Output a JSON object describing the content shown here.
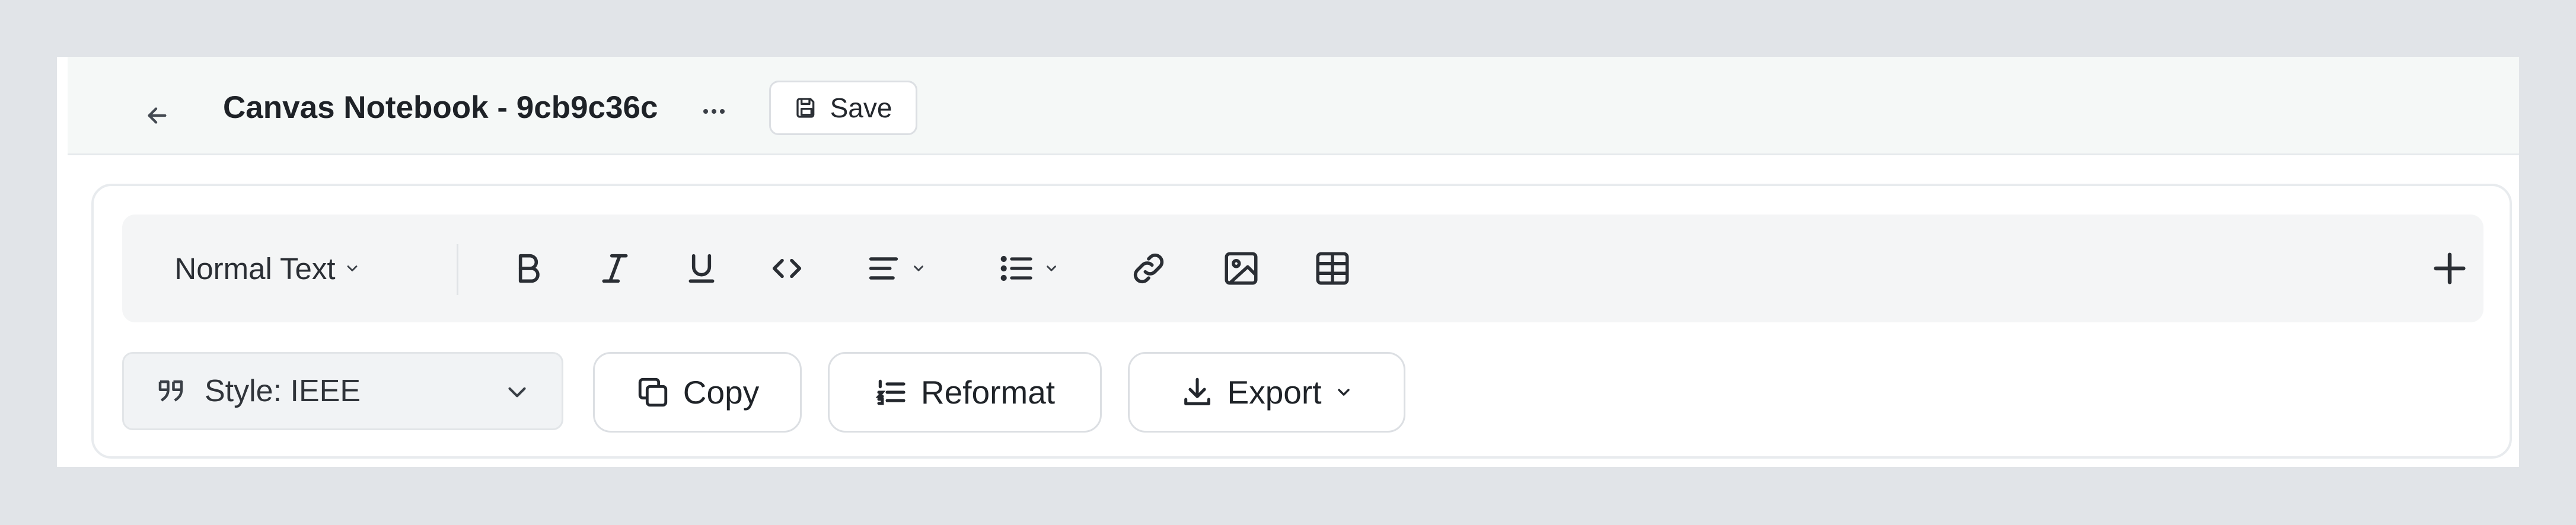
{
  "header": {
    "title": "Canvas Notebook - 9cb9c36c",
    "save_label": "Save"
  },
  "toolbar": {
    "text_style": "Normal Text",
    "buttons": [
      {
        "name": "bold",
        "icon": "bold-icon"
      },
      {
        "name": "italic",
        "icon": "italic-icon"
      },
      {
        "name": "underline",
        "icon": "underline-icon"
      },
      {
        "name": "code",
        "icon": "code-icon"
      },
      {
        "name": "align",
        "icon": "align-left-icon",
        "has_dropdown": true
      },
      {
        "name": "list",
        "icon": "list-icon",
        "has_dropdown": true
      },
      {
        "name": "link",
        "icon": "link-icon"
      },
      {
        "name": "image",
        "icon": "image-icon"
      },
      {
        "name": "table",
        "icon": "table-icon"
      },
      {
        "name": "add",
        "icon": "plus-icon"
      }
    ]
  },
  "actions": {
    "style_select": "Style: IEEE",
    "copy_label": "Copy",
    "reformat_label": "Reformat",
    "export_label": "Export"
  },
  "colors": {
    "page_bg": "#e1e4e8",
    "header_bg": "#f5f8f7",
    "toolbar_bg": "#f4f5f6",
    "text": "#1f2328"
  }
}
